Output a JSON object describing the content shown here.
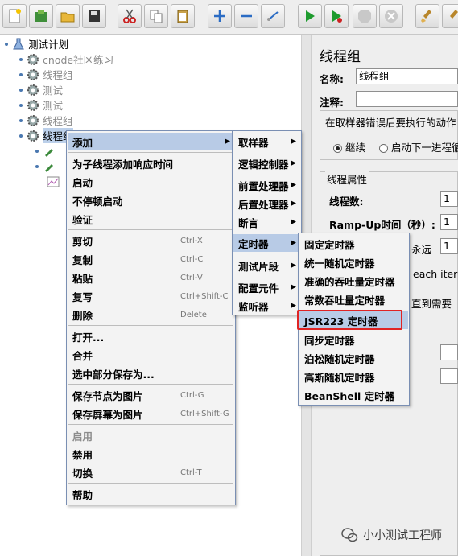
{
  "toolbar": {
    "buttons": [
      {
        "name": "new-icon"
      },
      {
        "name": "templates-icon"
      },
      {
        "name": "open-icon"
      },
      {
        "name": "save-icon"
      },
      {
        "name": "cut-icon"
      },
      {
        "name": "copy-icon"
      },
      {
        "name": "paste-icon"
      },
      {
        "name": "expand-icon"
      },
      {
        "name": "collapse-icon"
      },
      {
        "name": "toggle-icon"
      },
      {
        "name": "start-icon"
      },
      {
        "name": "start-no-pause-icon"
      },
      {
        "name": "stop-icon"
      },
      {
        "name": "shutdown-icon"
      },
      {
        "name": "clear-icon"
      },
      {
        "name": "clear-all-icon"
      }
    ]
  },
  "tree": {
    "root": "测试计划",
    "items": [
      "cnode社区练习",
      "线程组",
      "测试",
      "测试",
      "线程组",
      "线程组"
    ]
  },
  "context_menu": {
    "items": [
      {
        "label": "添加",
        "shortcut": "",
        "submenu": true
      },
      {
        "label": "为子线程添加响应时间",
        "shortcut": ""
      },
      {
        "label": "启动",
        "shortcut": ""
      },
      {
        "label": "不停顿启动",
        "shortcut": ""
      },
      {
        "label": "验证",
        "shortcut": ""
      },
      {
        "label": "剪切",
        "shortcut": "Ctrl-X"
      },
      {
        "label": "复制",
        "shortcut": "Ctrl-C"
      },
      {
        "label": "粘贴",
        "shortcut": "Ctrl-V"
      },
      {
        "label": "复写",
        "shortcut": "Ctrl+Shift-C"
      },
      {
        "label": "删除",
        "shortcut": "Delete"
      },
      {
        "label": "打开...",
        "shortcut": ""
      },
      {
        "label": "合并",
        "shortcut": ""
      },
      {
        "label": "选中部分保存为...",
        "shortcut": ""
      },
      {
        "label": "保存节点为图片",
        "shortcut": "Ctrl-G"
      },
      {
        "label": "保存屏幕为图片",
        "shortcut": "Ctrl+Shift-G"
      },
      {
        "label": "启用",
        "shortcut": ""
      },
      {
        "label": "禁用",
        "shortcut": ""
      },
      {
        "label": "切换",
        "shortcut": "Ctrl-T"
      },
      {
        "label": "帮助",
        "shortcut": ""
      }
    ]
  },
  "add_menu": {
    "items": [
      "取样器",
      "逻辑控制器",
      "前置处理器",
      "后置处理器",
      "断言",
      "定时器",
      "测试片段",
      "配置元件",
      "监听器"
    ]
  },
  "timer_menu": {
    "items": [
      "固定定时器",
      "统一随机定时器",
      "准确的吞吐量定时器",
      "常数吞吐量定时器",
      "JSR223 定时器",
      "同步定时器",
      "泊松随机定时器",
      "高斯随机定时器",
      "BeanShell 定时器"
    ]
  },
  "right_panel": {
    "title": "线程组",
    "name_label": "名称:",
    "name_value": "线程组",
    "comment_label": "注释:",
    "comment_value": "",
    "error_section": "在取样器错误后要执行的动作",
    "radio_continue": "继续",
    "radio_next_loop": "启动下一进程循环",
    "thread_props": "线程属性",
    "threads_label": "线程数:",
    "threads_value": "1",
    "rampup_label": "Ramp-Up时间（秒）:",
    "rampup_value": "1",
    "loop_forever": "永远",
    "loop_value": "1",
    "each_iteration": "each itera",
    "until_needed": "直到需要"
  },
  "watermark": "小小测试工程师",
  "colors": {
    "highlight": "#b8cbe6",
    "red_box": "#e02424",
    "menu_border": "#7a8fb3"
  }
}
